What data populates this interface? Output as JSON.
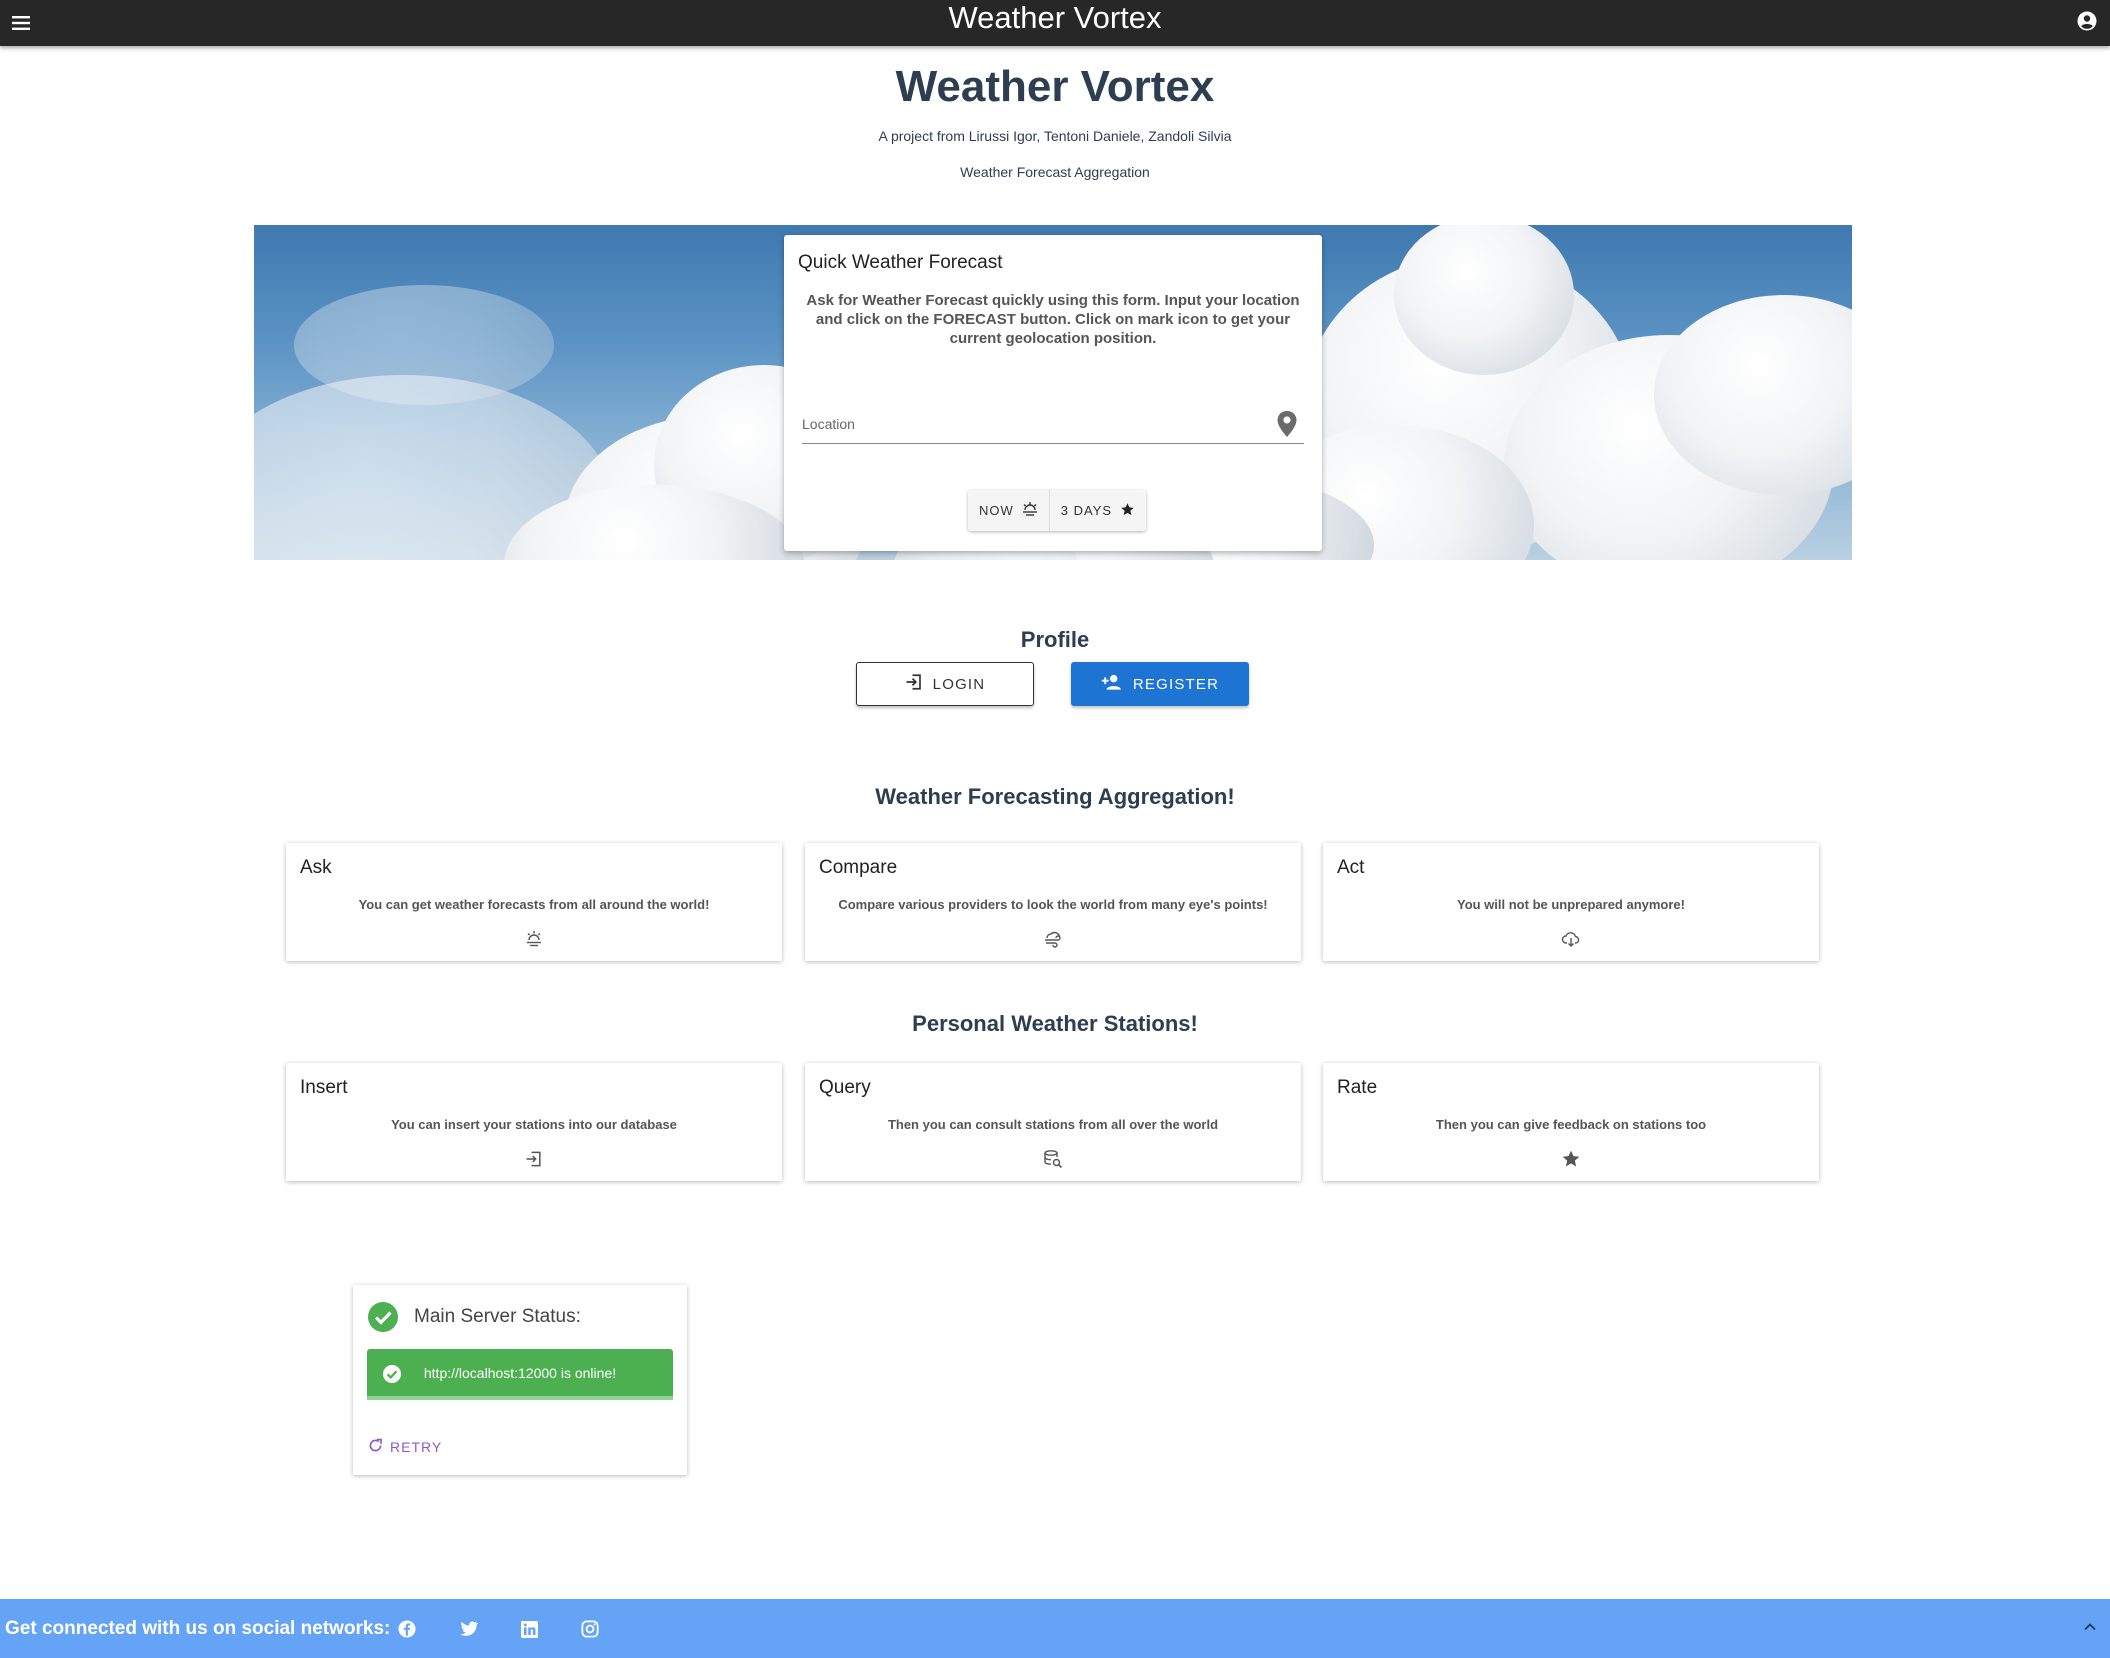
{
  "app_bar": {
    "title": "Weather Vortex",
    "menu_icon": "menu-icon",
    "account_icon": "account-circle-icon"
  },
  "header": {
    "title": "Weather Vortex",
    "authors": "A project from Lirussi Igor, Tentoni Daniele, Zandoli Silvia",
    "tagline": "Weather Forecast Aggregation"
  },
  "quick_forecast": {
    "title": "Quick Weather Forecast",
    "description": "Ask for Weather Forecast quickly using this form. Input your location and click on the FORECAST button. Click on mark icon to get your current geolocation position.",
    "location_placeholder": "Location",
    "location_value": "",
    "now_label": "NOW",
    "three_days_label": "3 DAYS"
  },
  "profile": {
    "title": "Profile",
    "login_label": "LOGIN",
    "register_label": "REGISTER"
  },
  "aggregation": {
    "title": "Weather Forecasting Aggregation!",
    "cards": [
      {
        "title": "Ask",
        "description": "You can get weather forecasts from all around the world!",
        "icon": "weather-sunset-icon"
      },
      {
        "title": "Compare",
        "description": "Compare various providers to look the world from many eye's points!",
        "icon": "weather-windy-icon"
      },
      {
        "title": "Act",
        "description": "You will not be unprepared anymore!",
        "icon": "cloud-download-icon"
      }
    ]
  },
  "stations": {
    "title": "Personal Weather Stations!",
    "cards": [
      {
        "title": "Insert",
        "description": "You can insert your stations into our database",
        "icon": "login-icon"
      },
      {
        "title": "Query",
        "description": "Then you can consult stations from all over the world",
        "icon": "database-search-icon"
      },
      {
        "title": "Rate",
        "description": "Then you can give feedback on stations too",
        "icon": "star-icon"
      }
    ]
  },
  "server_status": {
    "title": "Main Server Status:",
    "message": "http://localhost:12000 is online!",
    "retry_label": "RETRY",
    "status_color": "#4caf50"
  },
  "footer": {
    "text": "Get connected with us on social networks:",
    "social_icons": [
      "facebook-icon",
      "twitter-icon",
      "linkedin-icon",
      "instagram-icon"
    ],
    "background": "#64a3f5"
  },
  "colors": {
    "primary_button": "#1e74d2",
    "retry": "#8e5ac8",
    "app_bar": "#272727"
  }
}
